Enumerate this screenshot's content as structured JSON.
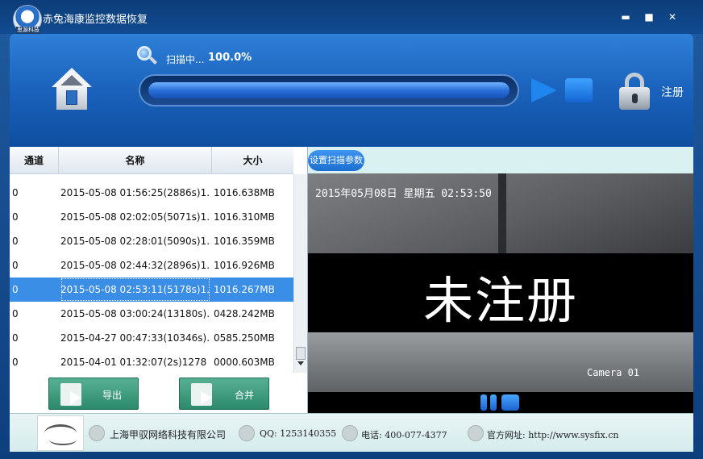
{
  "window": {
    "title": "赤兔海康监控数据恢复",
    "logo_text": "思源科技",
    "min": "▬",
    "max": "■",
    "close": "✕"
  },
  "scan": {
    "label": "扫描中...",
    "percent_text": "100.0%",
    "progress": 1.0
  },
  "header": {
    "register": "注册"
  },
  "list": {
    "columns": [
      "通道",
      "名称",
      "大小"
    ],
    "rows": [
      {
        "channel": "0",
        "name": "2015-05-08 01:56:25(2886s)1...",
        "size": "1016.638MB"
      },
      {
        "channel": "0",
        "name": "2015-05-08 02:02:05(5071s)1...",
        "size": "1016.310MB"
      },
      {
        "channel": "0",
        "name": "2015-05-08 02:28:01(5090s)1...",
        "size": "1016.359MB"
      },
      {
        "channel": "0",
        "name": "2015-05-08 02:44:32(2896s)1...",
        "size": "1016.926MB"
      },
      {
        "channel": "0",
        "name": "2015-05-08 02:53:11(5178s)1...",
        "size": "1016.267MB",
        "selected": true
      },
      {
        "channel": "0",
        "name": "2015-05-08 03:00:24(13180s)...",
        "size": "0428.242MB"
      },
      {
        "channel": "0",
        "name": "2015-04-27 00:47:33(10346s)...",
        "size": "0585.250MB"
      },
      {
        "channel": "0",
        "name": "2015-04-01 01:32:07(2s)1278",
        "size": "0000.603MB"
      }
    ]
  },
  "actions": {
    "export": "导出",
    "merge": "合并"
  },
  "preview": {
    "settings": "设置扫描参数",
    "osd_time": "2015年05月08日 星期五 02:53:50",
    "overlay": "未注册",
    "camera": "Camera 01"
  },
  "footer": {
    "company": "上海甲驭网络科技有限公司",
    "qq": "QQ: 1253140355",
    "phone": "电话: 400-077-4377",
    "website": "官方网址: http://www.sysfix.cn"
  }
}
